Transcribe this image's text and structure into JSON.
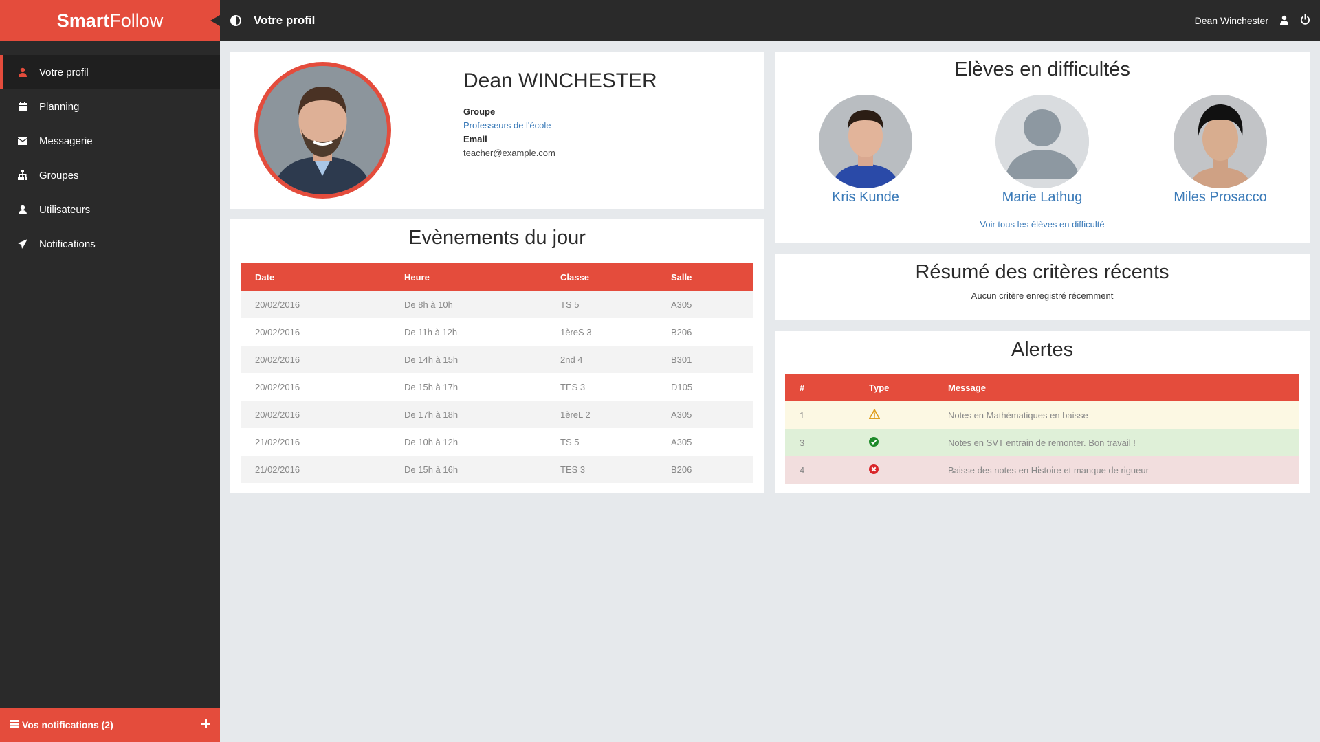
{
  "app": {
    "brand_bold": "Smart",
    "brand_light": "Follow"
  },
  "colors": {
    "accent": "#e44c3c",
    "sidebar": "#2a2a2a",
    "link": "#3a7ab8"
  },
  "sidebar": {
    "items": [
      {
        "label": "Votre profil",
        "icon": "user-icon",
        "active": true
      },
      {
        "label": "Planning",
        "icon": "calendar-icon"
      },
      {
        "label": "Messagerie",
        "icon": "envelope-icon"
      },
      {
        "label": "Groupes",
        "icon": "sitemap-icon"
      },
      {
        "label": "Utilisateurs",
        "icon": "user-icon"
      },
      {
        "label": "Notifications",
        "icon": "send-icon"
      }
    ],
    "notifications_label": "Vos notifications (2)"
  },
  "topbar": {
    "title": "Votre profil",
    "user_name": "Dean Winchester"
  },
  "profile": {
    "name": "Dean WINCHESTER",
    "group_label": "Groupe",
    "group_value": "Professeurs de l'école",
    "email_label": "Email",
    "email_value": "teacher@example.com"
  },
  "events": {
    "title": "Evènements du jour",
    "headers": [
      "Date",
      "Heure",
      "Classe",
      "Salle"
    ],
    "rows": [
      [
        "20/02/2016",
        "De 8h à 10h",
        "TS 5",
        "A305"
      ],
      [
        "20/02/2016",
        "De 11h à 12h",
        "1èreS 3",
        "B206"
      ],
      [
        "20/02/2016",
        "De 14h à 15h",
        "2nd 4",
        "B301"
      ],
      [
        "20/02/2016",
        "De 15h à 17h",
        "TES 3",
        "D105"
      ],
      [
        "20/02/2016",
        "De 17h à 18h",
        "1èreL 2",
        "A305"
      ],
      [
        "21/02/2016",
        "De 10h à 12h",
        "TS 5",
        "A305"
      ],
      [
        "21/02/2016",
        "De 15h à 16h",
        "TES 3",
        "B206"
      ]
    ]
  },
  "students": {
    "title": "Elèves en difficultés",
    "list": [
      {
        "name": "Kris Kunde"
      },
      {
        "name": "Marie Lathug"
      },
      {
        "name": "Miles Prosacco"
      }
    ],
    "see_all": "Voir tous les élèves en difficulté"
  },
  "criteria": {
    "title": "Résumé des critères récents",
    "empty": "Aucun critère enregistré récemment"
  },
  "alerts": {
    "title": "Alertes",
    "headers": [
      "#",
      "Type",
      "Message"
    ],
    "rows": [
      {
        "num": "1",
        "type": "warning-icon",
        "message": "Notes en Mathématiques en baisse"
      },
      {
        "num": "3",
        "type": "check-circle-icon",
        "message": "Notes en SVT entrain de remonter. Bon travail !"
      },
      {
        "num": "4",
        "type": "error-circle-icon",
        "message": "Baisse des notes en Histoire et manque de rigueur"
      }
    ]
  }
}
